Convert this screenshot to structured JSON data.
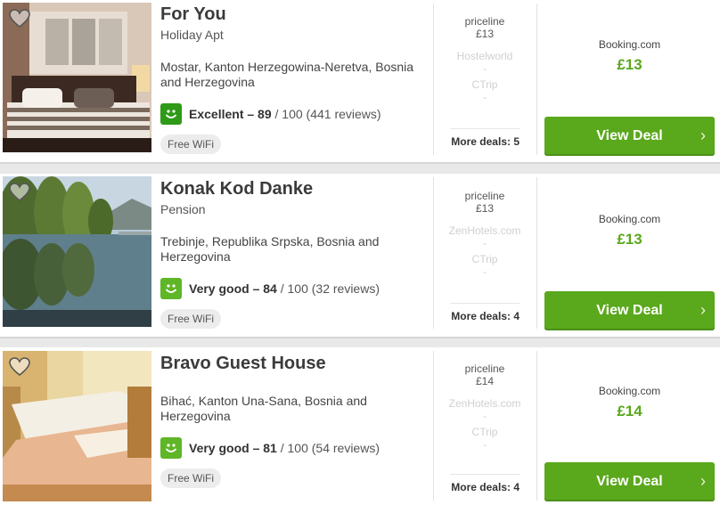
{
  "hotels": [
    {
      "name": "For You",
      "type": "Holiday Apt",
      "location": "Mostar, Kanton Herzegowina-Neretva, Bosnia and Herzegovina",
      "rating_word": "Excellent – 89",
      "rating_rest": " / 100 (441 reviews)",
      "amenity": "Free WiFi",
      "deals": [
        {
          "site": "priceline",
          "price": "£13",
          "faded": false
        },
        {
          "site": "Hostelworld",
          "price": "-",
          "faded": true
        },
        {
          "site": "CTrip",
          "price": "-",
          "faded": true
        }
      ],
      "more_deals": "More deals: 5",
      "best_site": "Booking.com",
      "best_price": "£13",
      "button": "View Deal"
    },
    {
      "name": "Konak Kod Danke",
      "type": "Pension",
      "location": "Trebinje, Republika Srpska, Bosnia and Herzegovina",
      "rating_word": "Very good – 84",
      "rating_rest": " / 100 (32 reviews)",
      "amenity": "Free WiFi",
      "deals": [
        {
          "site": "priceline",
          "price": "£13",
          "faded": false
        },
        {
          "site": "ZenHotels.com",
          "price": "-",
          "faded": true
        },
        {
          "site": "CTrip",
          "price": "-",
          "faded": true
        }
      ],
      "more_deals": "More deals: 4",
      "best_site": "Booking.com",
      "best_price": "£13",
      "button": "View Deal"
    },
    {
      "name": "Bravo Guest House",
      "type": "",
      "location": "Bihać, Kanton Una-Sana, Bosnia and Herzegovina",
      "rating_word": "Very good – 81",
      "rating_rest": " / 100 (54 reviews)",
      "amenity": "Free WiFi",
      "deals": [
        {
          "site": "priceline",
          "price": "£14",
          "faded": false
        },
        {
          "site": "ZenHotels.com",
          "price": "-",
          "faded": true
        },
        {
          "site": "CTrip",
          "price": "-",
          "faded": true
        }
      ],
      "more_deals": "More deals: 4",
      "best_site": "Booking.com",
      "best_price": "£14",
      "button": "View Deal"
    }
  ],
  "colors": {
    "accent": "#5aa81c",
    "smile": "#5fb626",
    "smile_excellent": "#2e9a17"
  },
  "icons": [
    "heart-icon",
    "smiley-icon",
    "chevron-right-icon"
  ]
}
